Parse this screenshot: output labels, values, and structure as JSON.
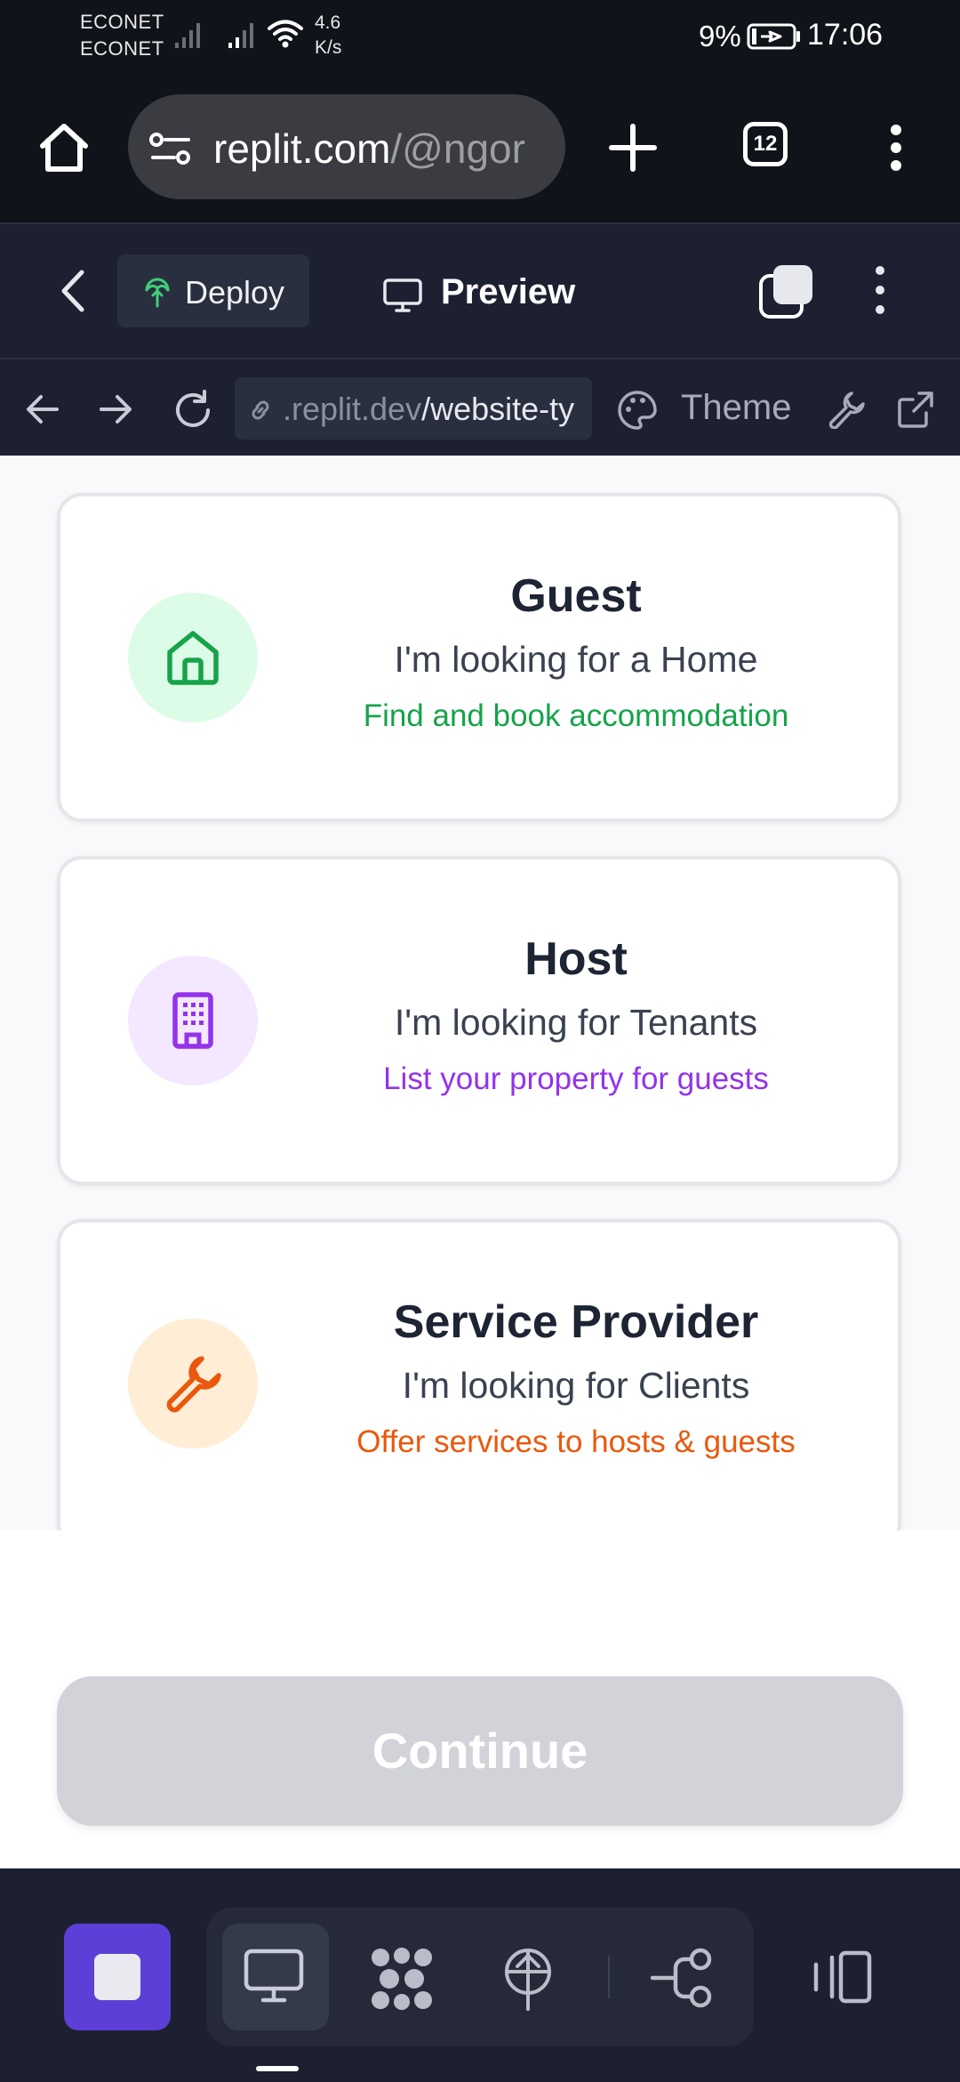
{
  "status_bar": {
    "carrier_1": "ECONET",
    "carrier_2": "ECONET",
    "network_speed_value": "4.6",
    "network_speed_unit": "K/s",
    "battery_percent": "9%",
    "time": "17:06"
  },
  "browser": {
    "url_host": "replit.com",
    "url_path": "/@ngor",
    "tab_count": "12",
    "icons": [
      "home-icon",
      "site-settings-icon",
      "plus-icon",
      "tabs-icon",
      "more-vertical-icon"
    ]
  },
  "replit_header": {
    "deploy_label": "Deploy",
    "preview_label": "Preview"
  },
  "webview_toolbar": {
    "url_host": ".replit.dev",
    "url_path": "/website-ty",
    "theme_label": "Theme"
  },
  "roles": [
    {
      "title": "Guest",
      "subtitle": "I'm looking for a Home",
      "description": "Find and book accommodation",
      "icon": "home-icon",
      "accent_color": "#16a34a",
      "icon_bg": "#dcfce7"
    },
    {
      "title": "Host",
      "subtitle": "I'm looking for Tenants",
      "description": "List your property for guests",
      "icon": "building-icon",
      "accent_color": "#9333ea",
      "icon_bg": "#f3e8ff"
    },
    {
      "title": "Service Provider",
      "subtitle": "I'm looking for Clients",
      "description": "Offer services to hosts & guests",
      "icon": "wrench-icon",
      "accent_color": "#ea580c",
      "icon_bg": "#ffedd5"
    }
  ],
  "continue_label": "Continue",
  "colors": {
    "brand_purple": "#5b3fd6",
    "continue_disabled": "#d1d3d9",
    "header_bg": "#1c2030"
  }
}
